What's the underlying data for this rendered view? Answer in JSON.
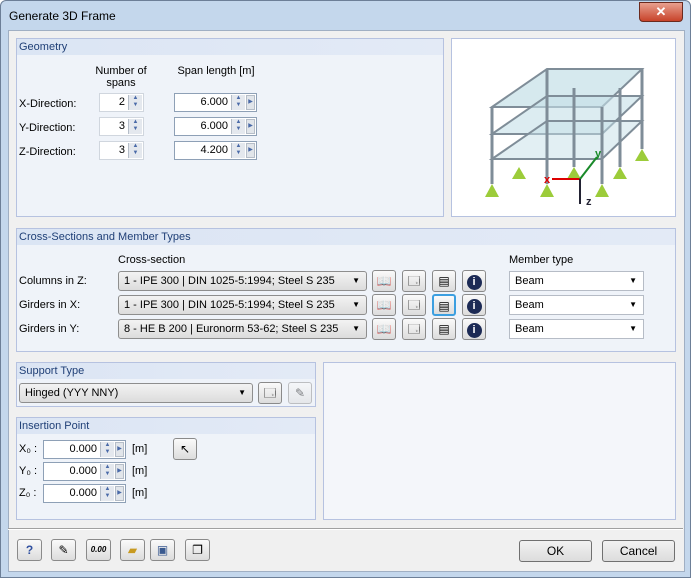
{
  "window": {
    "title": "Generate 3D Frame",
    "close": "✕"
  },
  "geometry": {
    "title": "Geometry",
    "col_spans": "Number of spans",
    "col_length": "Span length [m]",
    "rows": [
      {
        "label": "X-Direction:",
        "spans": "2",
        "length": "6.000"
      },
      {
        "label": "Y-Direction:",
        "spans": "3",
        "length": "6.000"
      },
      {
        "label": "Z-Direction:",
        "spans": "3",
        "length": "4.200"
      }
    ]
  },
  "preview": {
    "axes": {
      "x": "x",
      "y": "y",
      "z": "z"
    }
  },
  "cross_sections": {
    "title": "Cross-Sections and Member Types",
    "col_section": "Cross-section",
    "col_type": "Member type",
    "rows": [
      {
        "label": "Columns in Z:",
        "section": "1 - IPE 300 | DIN 1025-5:1994; Steel S 235",
        "type": "Beam"
      },
      {
        "label": "Girders in X:",
        "section": "1 - IPE 300 | DIN 1025-5:1994; Steel S 235",
        "type": "Beam"
      },
      {
        "label": "Girders in Y:",
        "section": "8 - HE B 200 | Euronorm 53-62; Steel S 235",
        "type": "Beam"
      }
    ]
  },
  "support": {
    "title": "Support Type",
    "value": "Hinged (YYY NNY)"
  },
  "insertion": {
    "title": "Insertion Point",
    "unit": "[m]",
    "rows": [
      {
        "label": "X₀ :",
        "value": "0.000"
      },
      {
        "label": "Y₀ :",
        "value": "0.000"
      },
      {
        "label": "Z₀ :",
        "value": "0.000"
      }
    ]
  },
  "footer": {
    "ok": "OK",
    "cancel": "Cancel",
    "units_icon_text": "0.00"
  }
}
